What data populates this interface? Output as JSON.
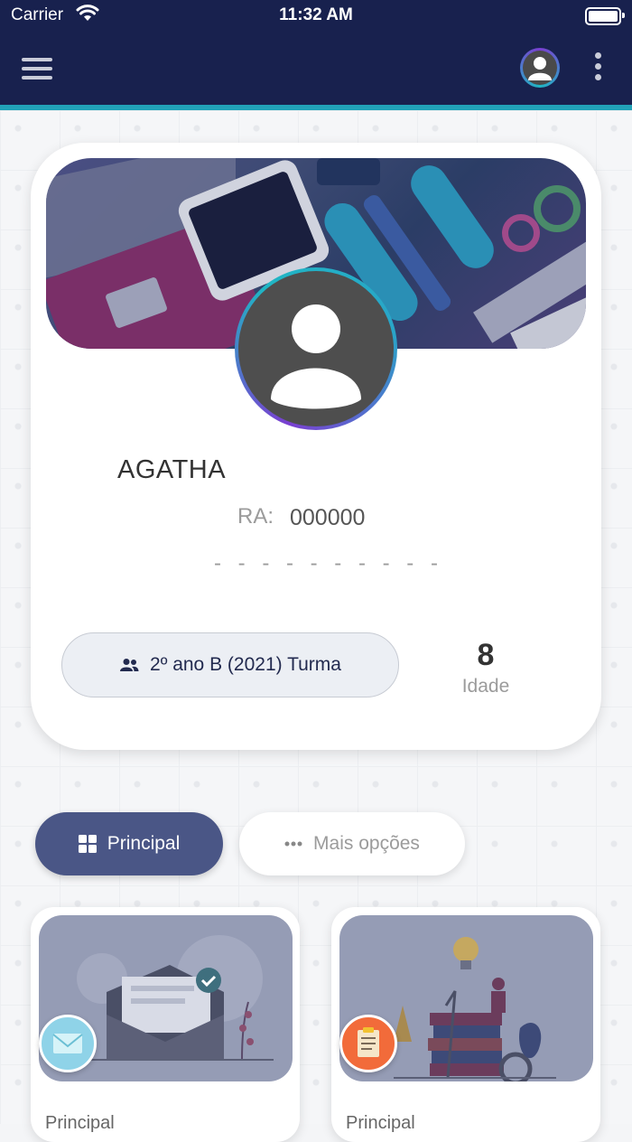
{
  "status_bar": {
    "carrier": "Carrier",
    "time": "11:32 AM"
  },
  "header": {
    "menu_icon": "hamburger-menu-icon",
    "avatar_icon": "user-avatar-icon",
    "more_icon": "vertical-dots-icon",
    "background_color": "#18214e",
    "accent_color": "#21a2b8"
  },
  "profile": {
    "name": "AGATHA",
    "ra_label": "RA:",
    "ra_value": "000000",
    "placeholder_dashes": "- - - - - - - - - -",
    "class_label": "2º ano B (2021) Turma",
    "age_value": "8",
    "age_label": "Idade"
  },
  "tabs": [
    {
      "label": "Principal",
      "icon": "grid-icon",
      "active": true
    },
    {
      "label": "Mais opções",
      "icon": "horizontal-dots-icon",
      "active": false
    }
  ],
  "cards": [
    {
      "title": "Principal",
      "badge_icon": "envelope-icon"
    },
    {
      "title": "Principal",
      "badge_icon": "clipboard-icon"
    }
  ]
}
